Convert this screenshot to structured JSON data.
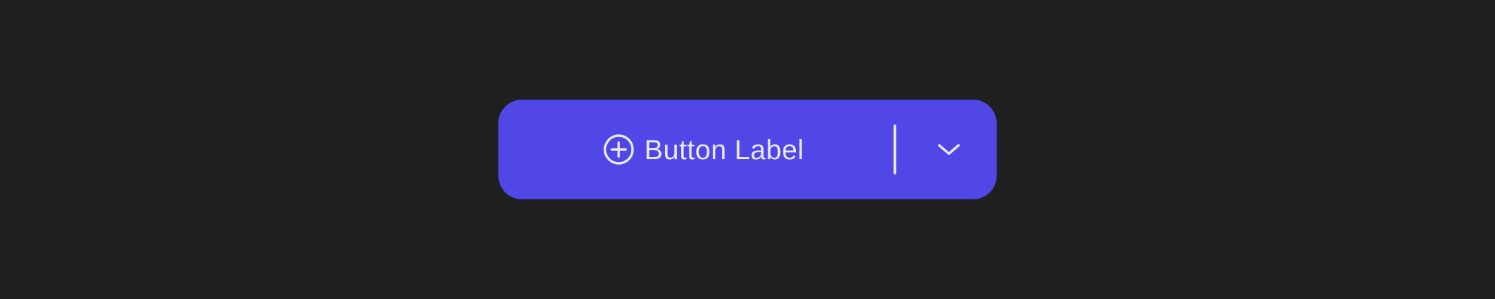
{
  "theme": {
    "background_color": "#1f1f1f",
    "button_color": "#5047e6",
    "foreground_color": "#e8e8f0"
  },
  "split_button": {
    "label": "Button Label",
    "leading_icon": "plus-circle-icon",
    "trailing_icon": "chevron-down-icon"
  }
}
